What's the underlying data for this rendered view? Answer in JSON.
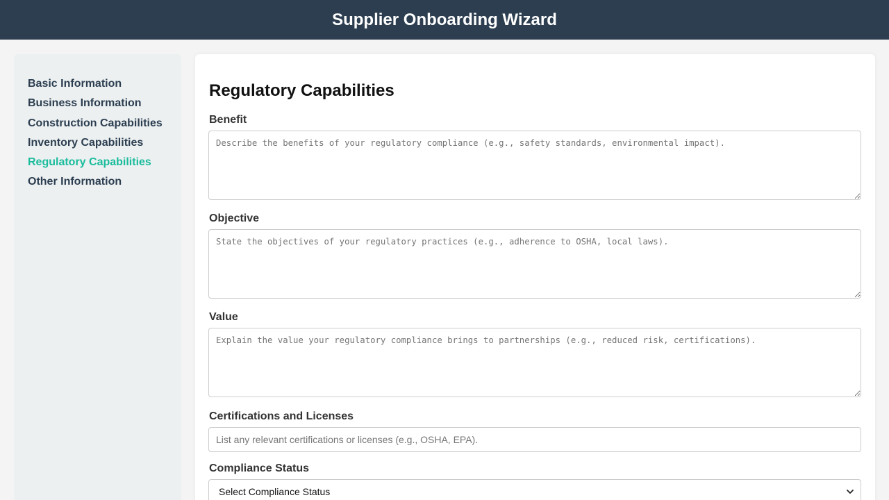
{
  "header": {
    "title": "Supplier Onboarding Wizard"
  },
  "sidebar": {
    "items": [
      {
        "label": "Basic Information"
      },
      {
        "label": "Business Information"
      },
      {
        "label": "Construction Capabilities"
      },
      {
        "label": "Inventory Capabilities"
      },
      {
        "label": "Regulatory Capabilities"
      },
      {
        "label": "Other Information"
      }
    ],
    "active_index": 4
  },
  "colors": {
    "header_bg": "#2c3e50",
    "active_nav": "#1abc9c",
    "sidebar_bg": "#ecf0f1"
  },
  "main": {
    "title": "Regulatory Capabilities",
    "benefit": {
      "label": "Benefit",
      "placeholder": "Describe the benefits of your regulatory compliance (e.g., safety standards, environmental impact).",
      "value": ""
    },
    "objective": {
      "label": "Objective",
      "placeholder": "State the objectives of your regulatory practices (e.g., adherence to OSHA, local laws).",
      "value": ""
    },
    "value_field": {
      "label": "Value",
      "placeholder": "Explain the value your regulatory compliance brings to partnerships (e.g., reduced risk, certifications).",
      "value": ""
    },
    "certifications": {
      "label": "Certifications and Licenses",
      "placeholder": "List any relevant certifications or licenses (e.g., OSHA, EPA).",
      "value": ""
    },
    "compliance": {
      "label": "Compliance Status",
      "selected": "Select Compliance Status",
      "icon": "chevron-down-icon"
    }
  }
}
